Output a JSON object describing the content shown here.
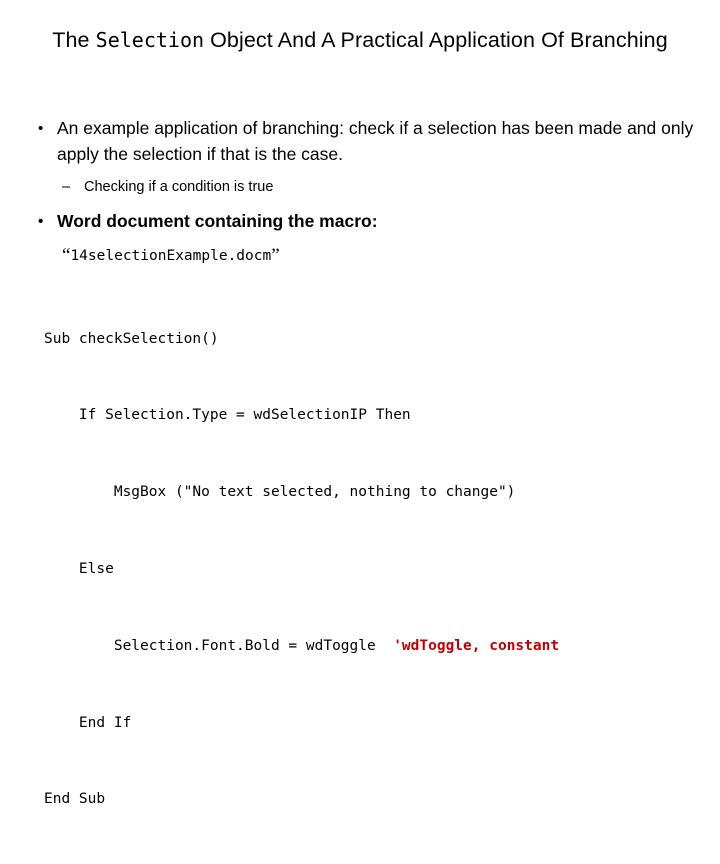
{
  "slide": {
    "title": {
      "prefix": "The ",
      "mono": "Selection",
      "suffix": " Object And A Practical Application Of Branching"
    },
    "bullets": [
      {
        "marker": "•",
        "text": "An example application of branching: check if a selection has been made and only apply the selection if that is the case.",
        "bold": false
      },
      {
        "marker": "•",
        "text": "Word document containing the macro:",
        "bold": true
      }
    ],
    "subbullet": {
      "marker": "–",
      "text": "Checking if a condition is true"
    },
    "filename": {
      "open_quote": "“",
      "name": "14selectionExample.docm",
      "close_quote": "”"
    },
    "code": {
      "lines": [
        {
          "text": "Sub checkSelection()",
          "comment": ""
        },
        {
          "text": "    If Selection.Type = wdSelectionIP Then",
          "comment": ""
        },
        {
          "text": "        MsgBox (\"No text selected, nothing to change\")",
          "comment": ""
        },
        {
          "text": "    Else",
          "comment": ""
        },
        {
          "text": "        Selection.Font.Bold = wdToggle  ",
          "comment": "'wdToggle, constant"
        },
        {
          "text": "    End If",
          "comment": ""
        },
        {
          "text": "End Sub",
          "comment": ""
        }
      ]
    },
    "colors": {
      "background": "#ffffff",
      "text": "#000000",
      "comment": "#C00000"
    }
  }
}
